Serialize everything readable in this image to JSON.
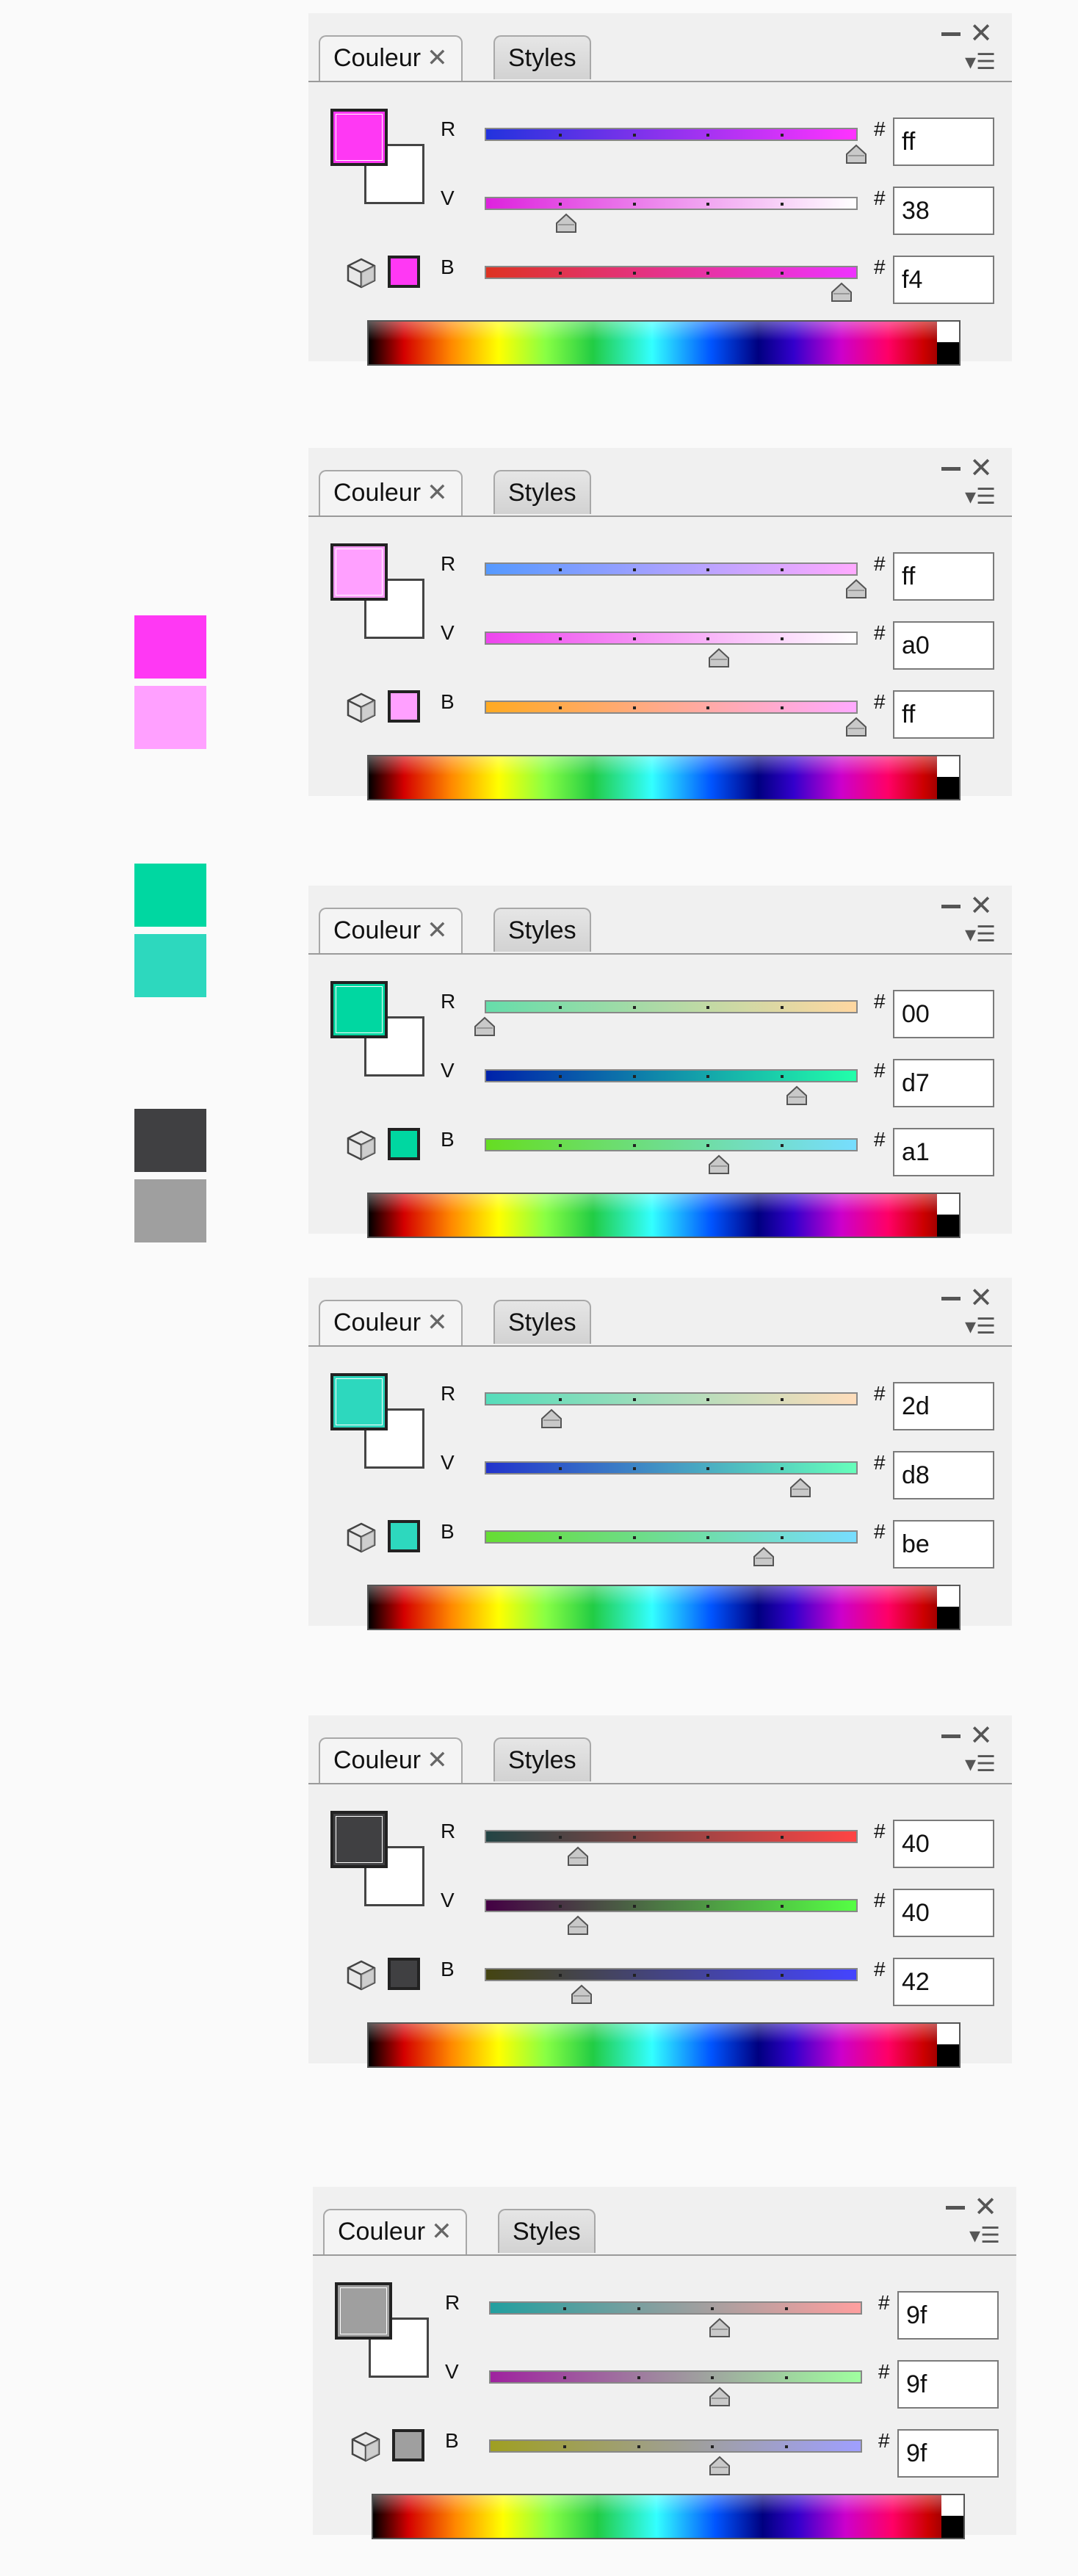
{
  "swatches": [
    {
      "color": "#ff38f4"
    },
    {
      "color": "#ffa0ff"
    },
    {
      "color": "#00d7a1"
    },
    {
      "color": "#2dd8be"
    },
    {
      "color": "#404042"
    },
    {
      "color": "#9f9f9f"
    }
  ],
  "panels": [
    {
      "tabs": {
        "color": "Couleur",
        "styles": "Styles"
      },
      "color": "#ff38f4",
      "channels": [
        {
          "label": "R",
          "value": "ff",
          "hash": "#",
          "level": 1.0,
          "gradient": [
            "#2233dd",
            "#ff33ff"
          ]
        },
        {
          "label": "V",
          "value": "38",
          "hash": "#",
          "level": 0.22,
          "gradient": [
            "#dd22dd",
            "#ffffff"
          ]
        },
        {
          "label": "B",
          "value": "f4",
          "hash": "#",
          "level": 0.96,
          "gradient": [
            "#dd3322",
            "#ee33ff"
          ]
        }
      ]
    },
    {
      "tabs": {
        "color": "Couleur",
        "styles": "Styles"
      },
      "color": "#ffa0ff",
      "channels": [
        {
          "label": "R",
          "value": "ff",
          "hash": "#",
          "level": 1.0,
          "gradient": [
            "#5599ff",
            "#ffaaff"
          ]
        },
        {
          "label": "V",
          "value": "a0",
          "hash": "#",
          "level": 0.63,
          "gradient": [
            "#ee44ee",
            "#ffffff"
          ]
        },
        {
          "label": "B",
          "value": "ff",
          "hash": "#",
          "level": 1.0,
          "gradient": [
            "#ffaa22",
            "#ffaaff"
          ]
        }
      ]
    },
    {
      "tabs": {
        "color": "Couleur",
        "styles": "Styles"
      },
      "color": "#00d7a1",
      "channels": [
        {
          "label": "R",
          "value": "00",
          "hash": "#",
          "level": 0.0,
          "gradient": [
            "#66ddaa",
            "#ffd7a1"
          ]
        },
        {
          "label": "V",
          "value": "d7",
          "hash": "#",
          "level": 0.84,
          "gradient": [
            "#0022aa",
            "#22ffaa"
          ]
        },
        {
          "label": "B",
          "value": "a1",
          "hash": "#",
          "level": 0.63,
          "gradient": [
            "#66dd22",
            "#77ddff"
          ]
        }
      ]
    },
    {
      "tabs": {
        "color": "Couleur",
        "styles": "Styles"
      },
      "color": "#2dd8be",
      "channels": [
        {
          "label": "R",
          "value": "2d",
          "hash": "#",
          "level": 0.18,
          "gradient": [
            "#55ddbb",
            "#ffddbb"
          ]
        },
        {
          "label": "V",
          "value": "d8",
          "hash": "#",
          "level": 0.85,
          "gradient": [
            "#2233cc",
            "#66ffbb"
          ]
        },
        {
          "label": "B",
          "value": "be",
          "hash": "#",
          "level": 0.75,
          "gradient": [
            "#66dd33",
            "#77ddff"
          ]
        }
      ]
    },
    {
      "tabs": {
        "color": "Couleur",
        "styles": "Styles"
      },
      "color": "#404042",
      "channels": [
        {
          "label": "R",
          "value": "40",
          "hash": "#",
          "level": 0.25,
          "gradient": [
            "#224444",
            "#ff4444"
          ]
        },
        {
          "label": "V",
          "value": "40",
          "hash": "#",
          "level": 0.25,
          "gradient": [
            "#440044",
            "#55ff44"
          ]
        },
        {
          "label": "B",
          "value": "42",
          "hash": "#",
          "level": 0.26,
          "gradient": [
            "#444411",
            "#4444ff"
          ]
        }
      ]
    },
    {
      "tabs": {
        "color": "Couleur",
        "styles": "Styles"
      },
      "color": "#9f9f9f",
      "channels": [
        {
          "label": "R",
          "value": "9f",
          "hash": "#",
          "level": 0.62,
          "gradient": [
            "#229f9f",
            "#ff9f9f"
          ]
        },
        {
          "label": "V",
          "value": "9f",
          "hash": "#",
          "level": 0.62,
          "gradient": [
            "#9f229f",
            "#9fff9f"
          ]
        },
        {
          "label": "B",
          "value": "9f",
          "hash": "#",
          "level": 0.62,
          "gradient": [
            "#9f9f22",
            "#9f9fff"
          ]
        }
      ]
    }
  ]
}
